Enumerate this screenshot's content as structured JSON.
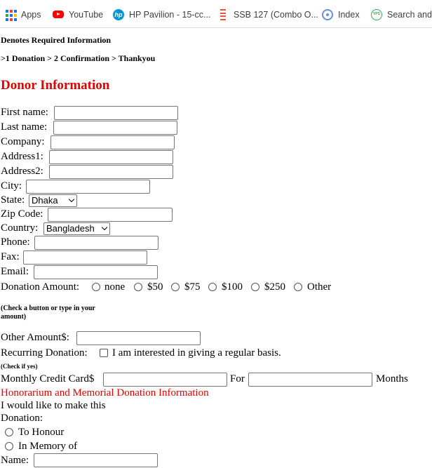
{
  "bookmarks": [
    {
      "label": "Apps",
      "icon": "apps-grid-icon"
    },
    {
      "label": "YouTube",
      "icon": "youtube-icon"
    },
    {
      "label": "HP Pavilion - 15-cc...",
      "icon": "hp-icon"
    },
    {
      "label": "SSB 127 (Combo O...",
      "icon": "ssb-icon"
    },
    {
      "label": "Index",
      "icon": "index-icon"
    },
    {
      "label": "Search and I",
      "icon": "vps-icon"
    }
  ],
  "form": {
    "required_note": "Denotes Required Information",
    "steps": ">1 Donation > 2 Confirmation > Thankyou",
    "title": "Donor Information",
    "fields": {
      "first_name": "First name:",
      "last_name": "Last name:",
      "company": "Company:",
      "address1": "Address1:",
      "address2": "Address2:",
      "city": "City:",
      "state": "State:",
      "zip": "Zip Code:",
      "country": "Country:",
      "phone": "Phone:",
      "fax": "Fax:",
      "email": "Email:"
    },
    "state_selected": "Dhaka",
    "country_selected": "Bangladesh",
    "donation_amount_label": "Donation Amount:",
    "amount_options": [
      "none",
      "$50",
      "$75",
      "$100",
      "$250",
      "Other"
    ],
    "check_hint": "(Check a button or type in your amount)",
    "other_amount_label": "Other Amount$:",
    "recurring_label": "Recurring Donation:",
    "recurring_option": "I am interested in giving a regular basis.",
    "check_if_yes": "(Check if yes)",
    "monthly_cc_label": "Monthly Credit Card$",
    "for_label": "For",
    "months_label": "Months",
    "honorarium_title": "Honorarium and Memorial Donation Information",
    "would_like_line1": "I would like to make this",
    "would_like_line2": "Donation:",
    "to_honour": "To Honour",
    "in_memory": "In Memory of",
    "name_label": "Name:"
  },
  "colors": {
    "title_red": "#e00000",
    "link_blue": "#1a73e8"
  }
}
